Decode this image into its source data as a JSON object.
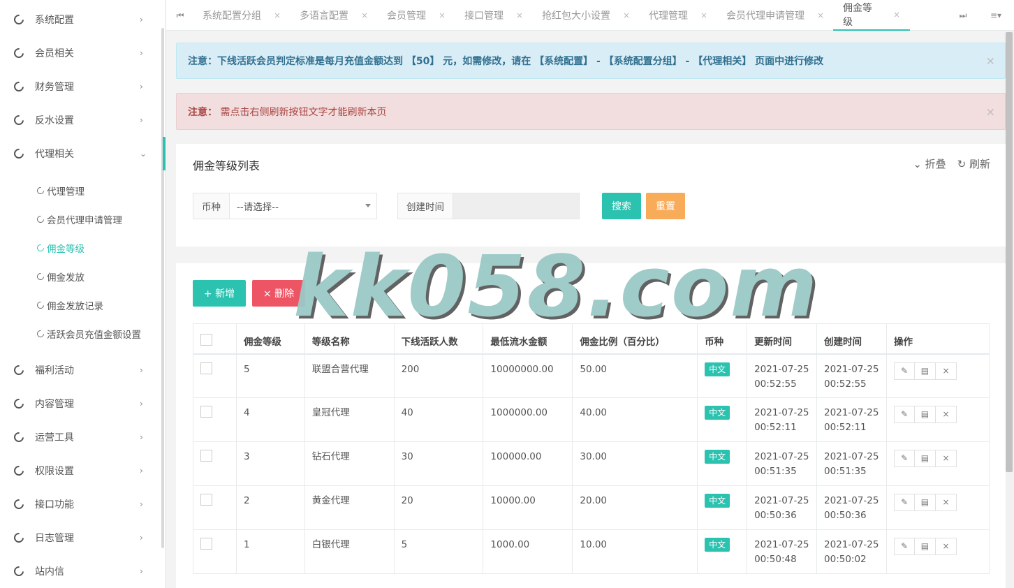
{
  "sidebar": {
    "items": [
      {
        "label": "系统配置",
        "chevron": "›"
      },
      {
        "label": "会员相关",
        "chevron": "›"
      },
      {
        "label": "财务管理",
        "chevron": "›"
      },
      {
        "label": "反水设置",
        "chevron": "›"
      },
      {
        "label": "代理相关",
        "chevron": "⌄"
      },
      {
        "label": "福利活动",
        "chevron": "›"
      },
      {
        "label": "内容管理",
        "chevron": "›"
      },
      {
        "label": "运营工具",
        "chevron": "›"
      },
      {
        "label": "权限设置",
        "chevron": "›"
      },
      {
        "label": "接口功能",
        "chevron": "›"
      },
      {
        "label": "日志管理",
        "chevron": "›"
      },
      {
        "label": "站内信",
        "chevron": "›"
      }
    ],
    "subitems": [
      {
        "label": "代理管理"
      },
      {
        "label": "会员代理申请管理"
      },
      {
        "label": "佣金等级"
      },
      {
        "label": "佣金发放"
      },
      {
        "label": "佣金发放记录"
      },
      {
        "label": "活跃会员充值金额设置"
      }
    ]
  },
  "tabs": {
    "first_icon": "⏮",
    "last_icon": "⏭",
    "menu_icon": "≡▾",
    "close": "×",
    "items": [
      {
        "label": "系统配置分组"
      },
      {
        "label": "多语言配置"
      },
      {
        "label": "会员管理"
      },
      {
        "label": "接口管理"
      },
      {
        "label": "抢红包大小设置"
      },
      {
        "label": "代理管理"
      },
      {
        "label": "会员代理申请管理"
      },
      {
        "label": "佣金等级"
      }
    ]
  },
  "alerts": {
    "info_prefix": "注意：",
    "info_text": "下线活跃会员判定标准是每月充值金额达到 【50】 元，如需修改，请在 【系统配置】 - 【系统配置分组】 - 【代理相关】 页面中进行修改",
    "danger_prefix": "注意：",
    "danger_text": " 需点击右侧刷新按钮文字才能刷新本页",
    "close": "×"
  },
  "panel": {
    "title": "佣金等级列表",
    "collapse": "⌄ 折叠",
    "refresh": "↻ 刷新"
  },
  "filter": {
    "currency_label": "币种",
    "currency_value": "--请选择--",
    "created_label": "创建时间",
    "search": "搜索",
    "reset": "重置"
  },
  "toolbar": {
    "add": "+ 新增",
    "delete": "× 删除"
  },
  "table": {
    "headers": [
      "佣金等级",
      "等级名称",
      "下线活跃人数",
      "最低流水金额",
      "佣金比例（百分比）",
      "币种",
      "更新时间",
      "创建时间",
      "操作"
    ],
    "rows": [
      {
        "level": "5",
        "name": "联盟合营代理",
        "active": "200",
        "min_flow": "10000000.00",
        "ratio": "50.00",
        "currency": "中文",
        "updated_date": "2021-07-25",
        "updated_time": "00:52:55",
        "created_date": "2021-07-25",
        "created_time": "00:52:55"
      },
      {
        "level": "4",
        "name": "皇冠代理",
        "active": "40",
        "min_flow": "1000000.00",
        "ratio": "40.00",
        "currency": "中文",
        "updated_date": "2021-07-25",
        "updated_time": "00:52:11",
        "created_date": "2021-07-25",
        "created_time": "00:52:11"
      },
      {
        "level": "3",
        "name": "钻石代理",
        "active": "30",
        "min_flow": "100000.00",
        "ratio": "30.00",
        "currency": "中文",
        "updated_date": "2021-07-25",
        "updated_time": "00:51:35",
        "created_date": "2021-07-25",
        "created_time": "00:51:35"
      },
      {
        "level": "2",
        "name": "黄金代理",
        "active": "20",
        "min_flow": "10000.00",
        "ratio": "20.00",
        "currency": "中文",
        "updated_date": "2021-07-25",
        "updated_time": "00:50:36",
        "created_date": "2021-07-25",
        "created_time": "00:50:36"
      },
      {
        "level": "1",
        "name": "白银代理",
        "active": "5",
        "min_flow": "1000.00",
        "ratio": "10.00",
        "currency": "中文",
        "updated_date": "2021-07-25",
        "updated_time": "00:50:48",
        "created_date": "2021-07-25",
        "created_time": "00:50:02"
      }
    ],
    "op_icons": {
      "edit": "✎",
      "detail": "▤",
      "remove": "×"
    }
  },
  "watermark": "kk058.com",
  "colors": {
    "accent": "#2bc2b0",
    "warning": "#f8ac59",
    "danger": "#ed5565"
  }
}
